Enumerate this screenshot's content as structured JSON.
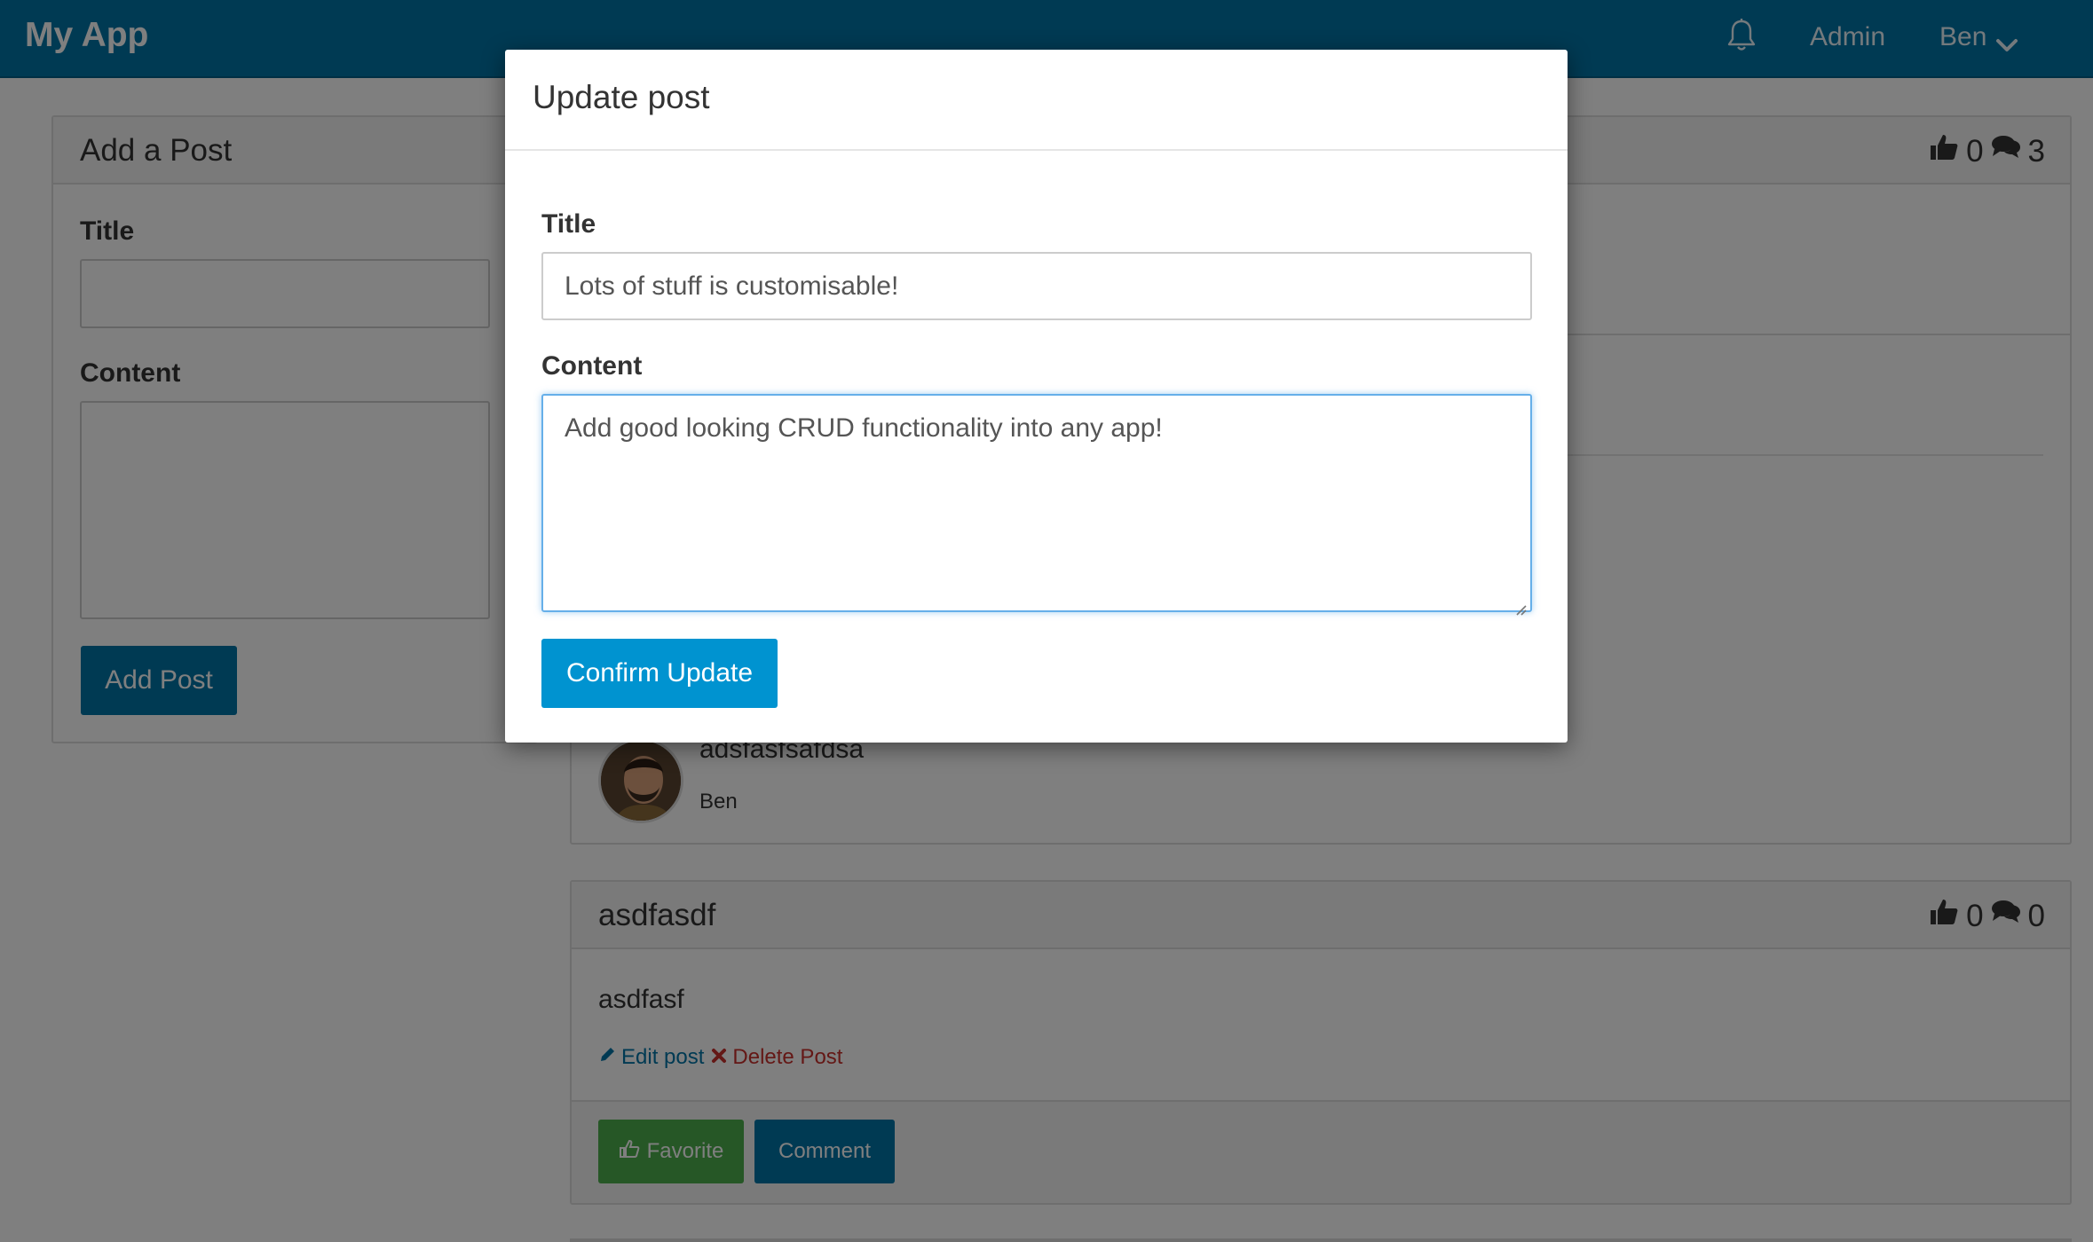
{
  "navbar": {
    "brand": "My App",
    "bell_icon": "bell-icon",
    "admin_link": "Admin",
    "user_menu": "Ben",
    "user_menu_icon": "chevron-down-icon",
    "bg_color": "#0074a6"
  },
  "add_post": {
    "heading": "Add a Post",
    "title_label": "Title",
    "title_value": "",
    "content_label": "Content",
    "content_value": "",
    "button_label": "Add Post"
  },
  "posts": [
    {
      "likes": "0",
      "comments_count": "3",
      "comment": {
        "text": "adsfasfsafdsa",
        "author": "Ben",
        "avatar": "avatar-photo"
      }
    },
    {
      "title": "asdfasdf",
      "likes": "0",
      "comments_count": "0",
      "content": "asdfasf",
      "edit_label": "Edit post",
      "delete_label": "Delete Post",
      "favorite_label": "Favorite",
      "comment_label": "Comment"
    }
  ],
  "modal": {
    "title": "Update post",
    "title_label": "Title",
    "title_value": "Lots of stuff is customisable!",
    "content_label": "Content",
    "content_value": "Add good looking CRUD functionality into any app!",
    "confirm_label": "Confirm Update",
    "accent_color": "#0093d0"
  }
}
